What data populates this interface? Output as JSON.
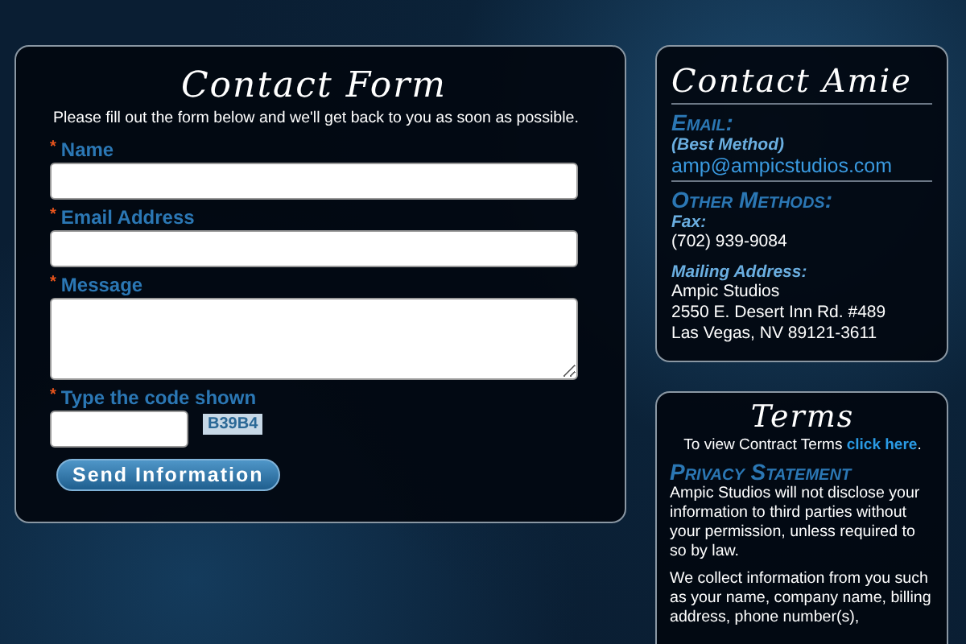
{
  "contact_form": {
    "title": "Contact Form",
    "intro": "Please fill out the form below and we'll get back to you as soon as possible.",
    "fields": [
      {
        "kind": "text",
        "required_mark": "*",
        "label": "Name"
      },
      {
        "kind": "text",
        "required_mark": "*",
        "label": "Email Address"
      },
      {
        "kind": "textarea",
        "required_mark": "*",
        "label": "Message"
      },
      {
        "kind": "captcha",
        "required_mark": "*",
        "label": "Type the code shown",
        "code": "B39B4"
      }
    ],
    "submit": "Send Information"
  },
  "contact_card": {
    "title": "Contact Amie",
    "email_heading": "Email:",
    "email_note": "(Best Method)",
    "email": "amp@ampicstudios.com",
    "other_heading": "Other Methods:",
    "fax_label": "Fax:",
    "fax": "(702) 939-9084",
    "address_label": "Mailing Address:",
    "address": [
      "Ampic Studios",
      "2550 E. Desert Inn Rd. #489",
      "Las Vegas, NV 89121-3611"
    ]
  },
  "terms_card": {
    "title": "Terms",
    "terms_text": "To view Contract Terms ",
    "terms_link": "click here",
    "terms_end": ".",
    "privacy_heading": "Privacy Statement",
    "paragraphs": [
      "Ampic Studios will not disclose your information to third parties without your permission, unless required to so by law.",
      "We collect information from you such as your name, company name, billing address, phone number(s),"
    ]
  }
}
